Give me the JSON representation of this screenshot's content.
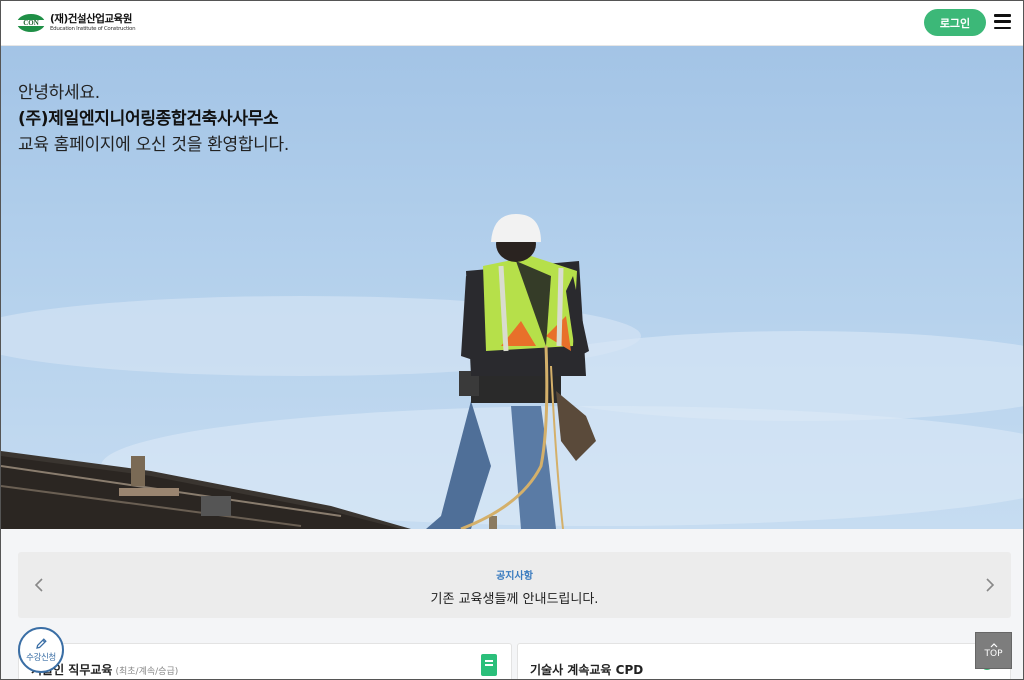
{
  "header": {
    "logo_mark_text": "CON",
    "logo_title": "(재)건설산업교육원",
    "logo_subtitle": "Education Institute of Construction",
    "login_label": "로그인",
    "menu_icon": "hamburger-menu-icon"
  },
  "hero": {
    "greeting": "안녕하세요.",
    "company": "(주)제일엔지니어링종합건축사사무소",
    "welcome": "교육 홈페이지에 오신 것을 환영합니다.",
    "image": "construction-worker-on-roof-photo"
  },
  "notice": {
    "label": "공지사항",
    "text": "기존 교육생들께 안내드립니다.",
    "prev_icon": "chevron-left-icon",
    "next_icon": "chevron-right-icon"
  },
  "cards": [
    {
      "title": "기술인 직무교육",
      "subtitle": "(최초/계속/승급)",
      "icon": "book-icon"
    },
    {
      "title": "기술사 계속교육 CPD",
      "subtitle": "",
      "icon": "award-icon"
    }
  ],
  "floating": {
    "apply_label": "수강신청",
    "apply_icon": "pencil-icon",
    "top_label": "TOP",
    "top_icon": "chevron-up-icon"
  },
  "colors": {
    "accent_green": "#3cb878",
    "notice_label_blue": "#3a7bbf",
    "apply_blue": "#3a6ea5"
  }
}
